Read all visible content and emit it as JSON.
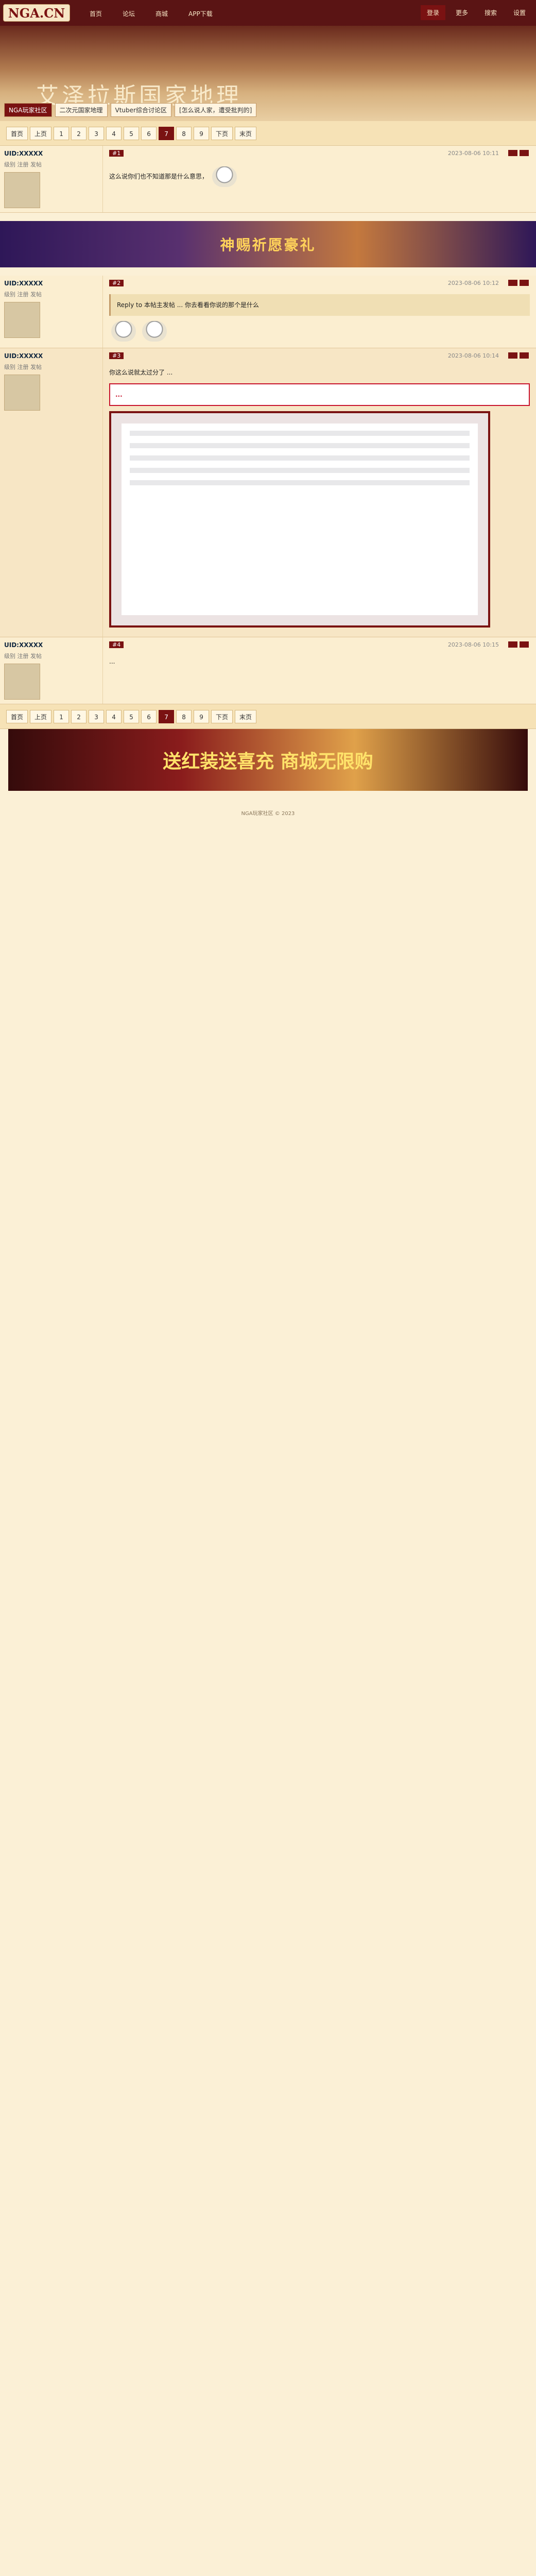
{
  "header": {
    "logo": "NGA.CN",
    "nav": [
      "首页",
      "论坛",
      "商城",
      "APP下载"
    ],
    "right": [
      "登录",
      "更多",
      "搜索",
      "设置"
    ]
  },
  "banner": {
    "title": "艾泽拉斯国家地理",
    "crumbs": [
      "NGA玩家社区",
      "二次元国家地理",
      "Vtuber综合讨论区",
      "[怎么说人家，遭受批判的]"
    ]
  },
  "pager": [
    "首页",
    "上页",
    "1",
    "2",
    "3",
    "4",
    "5",
    "6",
    "7",
    "8",
    "9",
    "下页",
    "末页"
  ],
  "posts": [
    {
      "user": "UID:XXXXX",
      "badge": "",
      "time": "2023-08-06 10:11",
      "floor": "#1",
      "content": "这么说你们也不知道那是什么意思，"
    },
    {
      "user": "UID:XXXXX",
      "badge": "",
      "time": "2023-08-06 10:12",
      "floor": "#2",
      "content": "Reply to 本帖主发帖 ... 你去看看你说的那个是什么"
    },
    {
      "user": "UID:XXXXX",
      "badge": "",
      "time": "2023-08-06 10:14",
      "floor": "#3",
      "content": "你这么说就太过分了 ..."
    },
    {
      "user": "UID:XXXXX",
      "badge": "",
      "time": "2023-08-06 10:15",
      "floor": "#4",
      "content": "..."
    }
  ],
  "ad_top": "神赐祈愿豪礼",
  "ad_bottom": "送红装送喜充 商城无限购",
  "footer": "NGA玩家社区 © 2023"
}
